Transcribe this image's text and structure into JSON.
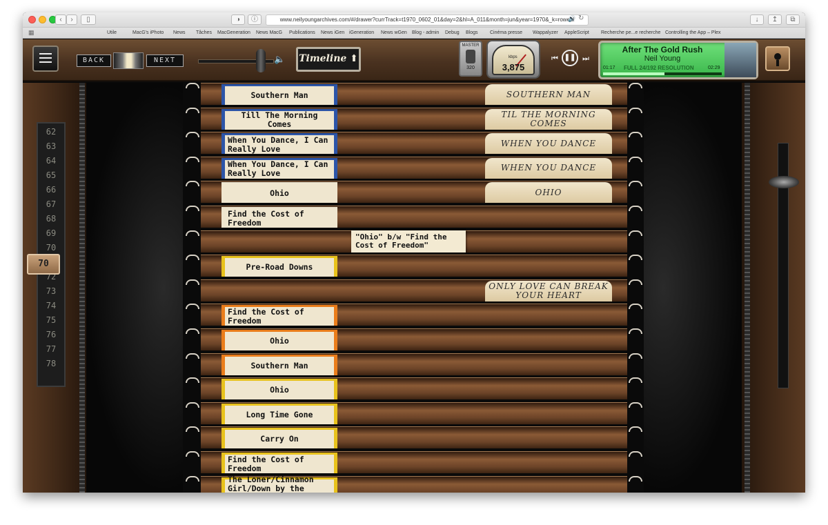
{
  "browser": {
    "url": "www.neilyoungarchives.com/#/drawer?currTrack=t1970_0602_01&day=2&hl=A_011&month=jun&year=1970&_k=roweul",
    "bookmarks": [
      "Utile",
      "MacG's iPhoto",
      "News",
      "Tâches",
      "MacGeneration",
      "News MacG",
      "Publications",
      "News iGen",
      "iGeneration",
      "News wGen",
      "Blog - admin",
      "Debug",
      "Blogs",
      "Cinéma presse",
      "Wappalyzer",
      "AppleScript",
      "Recherche pe...e recherche",
      "Controlling the App – Plex"
    ]
  },
  "toolbar": {
    "back_label": "BACK",
    "next_label": "NEXT",
    "timeline_label": "Timeline",
    "master_label": "MASTER",
    "master_value": "320",
    "kbps_label": "kbps",
    "kbps_value": "3,875",
    "volume_level": 0.7
  },
  "player": {
    "title": "After The Gold Rush",
    "artist": "Neil Young",
    "quality": "FULL 24/192 RESOLUTION",
    "elapsed": "01:17",
    "duration": "02:29",
    "progress": 0.52
  },
  "year_dial": {
    "years": [
      "62",
      "63",
      "64",
      "65",
      "66",
      "67",
      "68",
      "69",
      "70",
      "71",
      "72",
      "73",
      "74",
      "75",
      "76",
      "77",
      "78"
    ],
    "selected": "70"
  },
  "cards": [
    {
      "label": "Southern Man",
      "color": "#2c55a8",
      "hand": "SOUTHERN MAN"
    },
    {
      "label": "Till The Morning Comes",
      "color": "#2c55a8",
      "hand": "TIL THE MORNING COMES"
    },
    {
      "label": "When You Dance, I Can Really Love",
      "color": "#2c55a8",
      "hand": "WHEN YOU DANCE"
    },
    {
      "label": "When You Dance, I Can Really Love",
      "color": "#2c55a8",
      "hand": "WHEN YOU DANCE"
    },
    {
      "label": "Ohio",
      "color": "#efe6cf",
      "hand": "OHIO"
    },
    {
      "label": "Find the Cost of Freedom",
      "color": "#efe6cf",
      "hand": ""
    },
    {
      "label": "",
      "color": "",
      "hand": "",
      "sticky": "\"Ohio\" b/w \"Find the Cost of Freedom\""
    },
    {
      "label": "Pre-Road Downs",
      "color": "#e8c21c",
      "hand": ""
    },
    {
      "label": "",
      "color": "",
      "hand": "ONLY LOVE CAN BREAK YOUR HEART"
    },
    {
      "label": "Find the Cost of Freedom",
      "color": "#ea7d1b",
      "hand": ""
    },
    {
      "label": "Ohio",
      "color": "#ea7d1b",
      "hand": ""
    },
    {
      "label": "Southern Man",
      "color": "#ea7d1b",
      "hand": ""
    },
    {
      "label": "Ohio",
      "color": "#e8c21c",
      "hand": ""
    },
    {
      "label": "Long Time Gone",
      "color": "#e8c21c",
      "hand": ""
    },
    {
      "label": "Carry On",
      "color": "#e8c21c",
      "hand": ""
    },
    {
      "label": "Find the Cost of Freedom",
      "color": "#e8c21c",
      "hand": ""
    },
    {
      "label": "The Loner/Cinnamon Girl/Down by the River",
      "color": "#e8c21c",
      "hand": ""
    }
  ]
}
